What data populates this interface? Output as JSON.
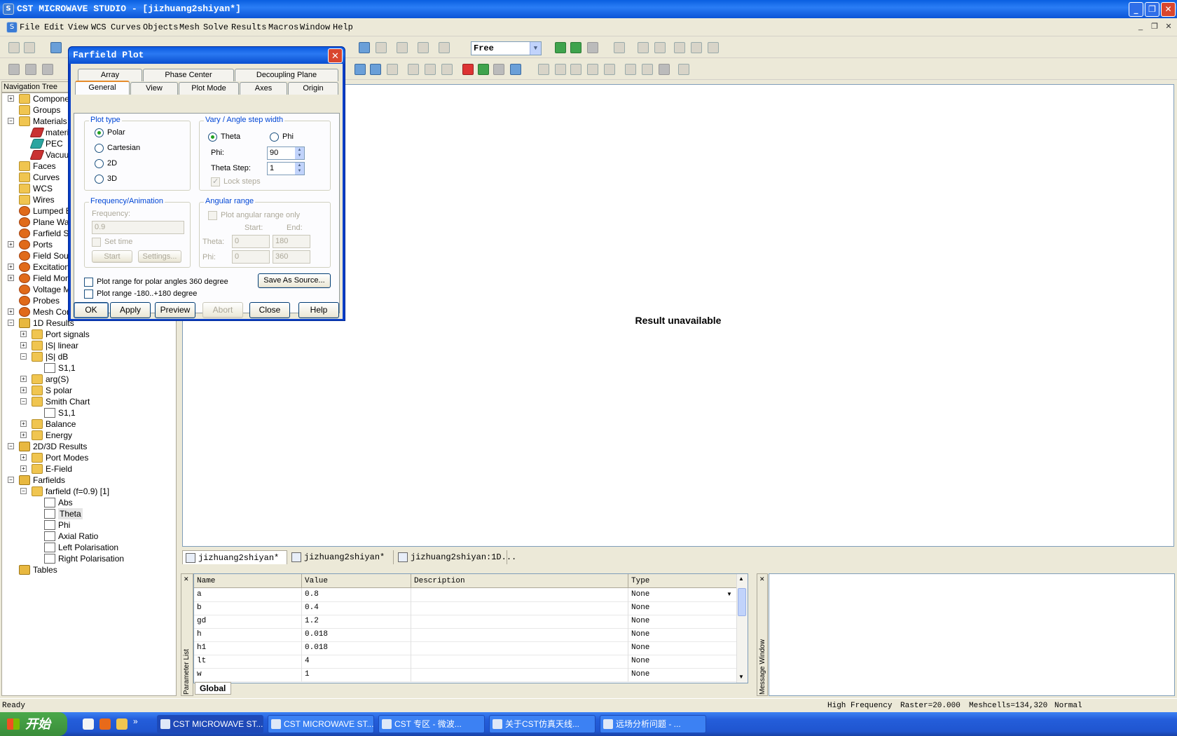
{
  "window": {
    "title": "CST MICROWAVE STUDIO - [jizhuang2shiyan*]",
    "minimize": "_",
    "maximize": "❐",
    "close": "✕"
  },
  "menu": [
    "File",
    "Edit",
    "View",
    "WCS",
    "Curves",
    "Objects",
    "Mesh",
    "Solve",
    "Results",
    "Macros",
    "Window",
    "Help"
  ],
  "toolbar": {
    "mode_value": "Free"
  },
  "nav": {
    "header": "Navigation Tree",
    "items": [
      {
        "label": "Components",
        "x": 0,
        "exp": "+",
        "icon": "folder"
      },
      {
        "label": "Groups",
        "x": 0,
        "exp": "",
        "icon": "folder"
      },
      {
        "label": "Materials",
        "x": 0,
        "exp": "−",
        "icon": "folder"
      },
      {
        "label": "material1",
        "x": 18,
        "exp": "",
        "icon": "red"
      },
      {
        "label": "PEC",
        "x": 18,
        "exp": "",
        "icon": "teal"
      },
      {
        "label": "Vacuum",
        "x": 18,
        "exp": "",
        "icon": "red"
      },
      {
        "label": "Faces",
        "x": 0,
        "exp": "",
        "icon": "folder"
      },
      {
        "label": "Curves",
        "x": 0,
        "exp": "",
        "icon": "folder"
      },
      {
        "label": "WCS",
        "x": 0,
        "exp": "",
        "icon": "folder"
      },
      {
        "label": "Wires",
        "x": 0,
        "exp": "",
        "icon": "folder"
      },
      {
        "label": "Lumped Elements",
        "x": 0,
        "exp": "",
        "icon": "gear"
      },
      {
        "label": "Plane Wave",
        "x": 0,
        "exp": "",
        "icon": "gear"
      },
      {
        "label": "Farfield Sources",
        "x": 0,
        "exp": "",
        "icon": "gear"
      },
      {
        "label": "Ports",
        "x": 0,
        "exp": "+",
        "icon": "gear"
      },
      {
        "label": "Field Sources",
        "x": 0,
        "exp": "",
        "icon": "gear"
      },
      {
        "label": "Excitation Signals",
        "x": 0,
        "exp": "+",
        "icon": "gear"
      },
      {
        "label": "Field Monitors",
        "x": 0,
        "exp": "+",
        "icon": "gear"
      },
      {
        "label": "Voltage Monitors",
        "x": 0,
        "exp": "",
        "icon": "gear"
      },
      {
        "label": "Probes",
        "x": 0,
        "exp": "",
        "icon": "gear"
      },
      {
        "label": "Mesh Control",
        "x": 0,
        "exp": "+",
        "icon": "gear"
      },
      {
        "label": "1D Results",
        "x": 0,
        "exp": "−",
        "icon": "fold2"
      },
      {
        "label": "Port signals",
        "x": 18,
        "exp": "+",
        "icon": "folder"
      },
      {
        "label": "|S| linear",
        "x": 18,
        "exp": "+",
        "icon": "folder"
      },
      {
        "label": "|S| dB",
        "x": 18,
        "exp": "−",
        "icon": "folder"
      },
      {
        "label": "S1,1",
        "x": 36,
        "exp": "",
        "icon": "res"
      },
      {
        "label": "arg(S)",
        "x": 18,
        "exp": "+",
        "icon": "folder"
      },
      {
        "label": "S polar",
        "x": 18,
        "exp": "+",
        "icon": "folder"
      },
      {
        "label": "Smith Chart",
        "x": 18,
        "exp": "−",
        "icon": "folder"
      },
      {
        "label": "S1,1",
        "x": 36,
        "exp": "",
        "icon": "res"
      },
      {
        "label": "Balance",
        "x": 18,
        "exp": "+",
        "icon": "folder"
      },
      {
        "label": "Energy",
        "x": 18,
        "exp": "+",
        "icon": "folder"
      },
      {
        "label": "2D/3D Results",
        "x": 0,
        "exp": "−",
        "icon": "fold2"
      },
      {
        "label": "Port Modes",
        "x": 18,
        "exp": "+",
        "icon": "folder"
      },
      {
        "label": "E-Field",
        "x": 18,
        "exp": "+",
        "icon": "folder"
      },
      {
        "label": "Farfields",
        "x": 0,
        "exp": "−",
        "icon": "fold2"
      },
      {
        "label": "farfield (f=0.9) [1]",
        "x": 18,
        "exp": "−",
        "icon": "folder"
      },
      {
        "label": "Abs",
        "x": 36,
        "exp": "",
        "icon": "res"
      },
      {
        "label": "Theta",
        "x": 36,
        "exp": "",
        "icon": "res",
        "sel": true
      },
      {
        "label": "Phi",
        "x": 36,
        "exp": "",
        "icon": "res"
      },
      {
        "label": "Axial Ratio",
        "x": 36,
        "exp": "",
        "icon": "res"
      },
      {
        "label": "Left Polarisation",
        "x": 36,
        "exp": "",
        "icon": "res"
      },
      {
        "label": "Right Polarisation",
        "x": 36,
        "exp": "",
        "icon": "res"
      },
      {
        "label": "Tables",
        "x": 0,
        "exp": "",
        "icon": "fold2"
      }
    ]
  },
  "main": {
    "message": "Result unavailable"
  },
  "doctabs": [
    "jizhuang2shiyan*",
    "jizhuang2shiyan*",
    "jizhuang2shiyan:1D..."
  ],
  "params": {
    "panel_label": "Parameter List",
    "columns": [
      "Name",
      "Value",
      "Description",
      "Type"
    ],
    "rows": [
      [
        "a",
        "0.8",
        "",
        "None"
      ],
      [
        "b",
        "0.4",
        "",
        "None"
      ],
      [
        "gd",
        "1.2",
        "",
        "None"
      ],
      [
        "h",
        "0.018",
        "",
        "None"
      ],
      [
        "h1",
        "0.018",
        "",
        "None"
      ],
      [
        "lt",
        "4",
        "",
        "None"
      ],
      [
        "w",
        "1",
        "",
        "None"
      ]
    ],
    "tab": "Global"
  },
  "message_window": {
    "label": "Message Window"
  },
  "status": {
    "ready": "Ready",
    "freq": "High Frequency",
    "raster": "Raster=20.000",
    "mesh": "Meshcells=134,320",
    "normal": "Normal"
  },
  "taskbar": {
    "start": "开始",
    "tasks": [
      "CST MICROWAVE ST...",
      "CST MICROWAVE ST...",
      "CST 专区 - 微波...",
      "关于CST仿真天线...",
      "远场分析问题 - ..."
    ]
  },
  "dialog": {
    "title": "Farfield Plot",
    "close": "✕",
    "tabs_row1": [
      "Array",
      "Phase Center",
      "Decoupling Plane"
    ],
    "tabs_row2": [
      "General",
      "View",
      "Plot Mode",
      "Axes",
      "Origin"
    ],
    "plot_type": {
      "title": "Plot type",
      "options": [
        "Polar",
        "Cartesian",
        "2D",
        "3D"
      ],
      "selected": "Polar"
    },
    "vary": {
      "title": "Vary / Angle step width",
      "theta": "Theta",
      "phi": "Phi",
      "phi_label": "Phi:",
      "phi_value": "90",
      "step_label": "Theta Step:",
      "step_value": "1",
      "lock": "Lock steps"
    },
    "freq": {
      "title": "Frequency/Animation",
      "freq_label": "Frequency:",
      "freq_value": "0.9",
      "set_time": "Set time",
      "start": "Start",
      "settings": "Settings..."
    },
    "angular": {
      "title": "Angular range",
      "only": "Plot angular range only",
      "start": "Start:",
      "end": "End:",
      "theta": "Theta:",
      "phi": "Phi:",
      "theta_start": "0",
      "theta_end": "180",
      "phi_start": "0",
      "phi_end": "360"
    },
    "opt360": "Plot range for polar angles 360 degree",
    "opt180": "Plot range -180..+180 degree",
    "save": "Save As Source...",
    "buttons": {
      "ok": "OK",
      "apply": "Apply",
      "preview": "Preview",
      "abort": "Abort",
      "close": "Close",
      "help": "Help"
    }
  }
}
